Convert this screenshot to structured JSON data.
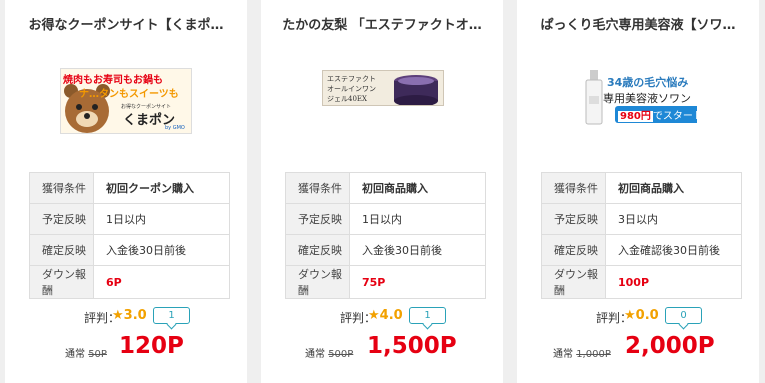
{
  "cards": [
    {
      "title": "お得なクーポンサイト【くまポ…",
      "banner": {
        "lines": [
          "焼肉もお寿司もお鍋も",
          "ナ…タンもスイーツも",
          "お得なクーポンサイト",
          "くまポン",
          "by GMO"
        ]
      },
      "rows": [
        {
          "label": "獲得条件",
          "value": "初回クーポン購入"
        },
        {
          "label": "予定反映",
          "value": "1日以内"
        },
        {
          "label": "確定反映",
          "value": "入金後30日前後"
        },
        {
          "label": "ダウン報酬",
          "value": "6P"
        }
      ],
      "rating_label": "評判：",
      "rating": "★3.0",
      "reviews": "1",
      "normal_label": "通常",
      "normal_price": "50P",
      "price": "120P"
    },
    {
      "title": "たかの友梨 「エステファクトオ…",
      "banner": {
        "lines": [
          "エステファクト",
          "オールインワン",
          "ジェル40EX"
        ]
      },
      "rows": [
        {
          "label": "獲得条件",
          "value": "初回商品購入"
        },
        {
          "label": "予定反映",
          "value": "1日以内"
        },
        {
          "label": "確定反映",
          "value": "入金後30日前後"
        },
        {
          "label": "ダウン報酬",
          "value": "75P"
        }
      ],
      "rating_label": "評判：",
      "rating": "★4.0",
      "reviews": "1",
      "normal_label": "通常",
      "normal_price": "500P",
      "price": "1,500P"
    },
    {
      "title": "ぱっくり毛穴専用美容液【ソワ…",
      "banner": {
        "lines": [
          "34歳の毛穴悩み",
          "専用美容液ソワン",
          "980円",
          "でスタート!"
        ]
      },
      "rows": [
        {
          "label": "獲得条件",
          "value": "初回商品購入"
        },
        {
          "label": "予定反映",
          "value": "3日以内"
        },
        {
          "label": "確定反映",
          "value": "入金確認後30日前後"
        },
        {
          "label": "ダウン報酬",
          "value": "100P"
        }
      ],
      "rating_label": "評判：",
      "rating": "★0.0",
      "reviews": "0",
      "normal_label": "通常",
      "normal_price": "1,000P",
      "price": "2,000P"
    }
  ],
  "colors": {
    "accent_red": "#e60012",
    "star": "#f2a100",
    "badge": "#2aa2b8"
  }
}
